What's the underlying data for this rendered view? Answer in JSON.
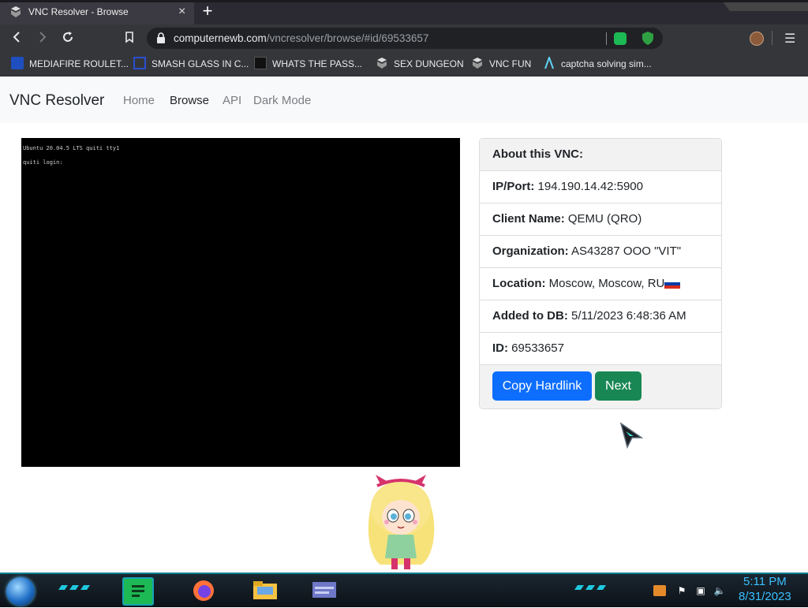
{
  "browser": {
    "tab_title": "VNC Resolver - Browse",
    "tab_close": "×",
    "new_tab": "+",
    "url_host": "computernewb.com",
    "url_path": "/vncresolver/browse/#id/69533657",
    "bookmarks": [
      {
        "label": "MEDIAFIRE ROULET...",
        "icon": "mediafire-icon"
      },
      {
        "label": "SMASH GLASS IN C...",
        "icon": "glass-icon"
      },
      {
        "label": "WHATS THE PASS...",
        "icon": "bookmark-icon"
      },
      {
        "label": "SEX DUNGEON",
        "icon": "vnc-icon"
      },
      {
        "label": "VNC FUN",
        "icon": "vnc-icon"
      },
      {
        "label": "captcha solving sim...",
        "icon": "captcha-icon"
      }
    ]
  },
  "site": {
    "brand": "VNC Resolver",
    "nav": [
      "Home",
      "Browse",
      "API",
      "Dark Mode"
    ],
    "active_nav": "Browse"
  },
  "vnc_screen": {
    "line1": "Ubuntu 20.04.5 LTS quiti tty1",
    "line2": "quiti login:"
  },
  "card": {
    "title": "About this VNC:",
    "rows": [
      {
        "label": "IP/Port:",
        "value": "194.190.14.42:5900"
      },
      {
        "label": "Client Name:",
        "value": "QEMU (QRO)"
      },
      {
        "label": "Organization:",
        "value": "AS43287 OOO \"VIT\""
      },
      {
        "label": "Location:",
        "value": "Moscow, Moscow, RU"
      },
      {
        "label": "Added to DB:",
        "value": "5/11/2023 6:48:36 AM"
      },
      {
        "label": "ID:",
        "value": "69533657"
      }
    ],
    "copy_button": "Copy Hardlink",
    "next_button": "Next"
  },
  "taskbar": {
    "time": "5:11 PM",
    "date": "8/31/2023"
  },
  "colors": {
    "primary": "#0d6efd",
    "success": "#198754",
    "clock": "#3ac0ff"
  }
}
